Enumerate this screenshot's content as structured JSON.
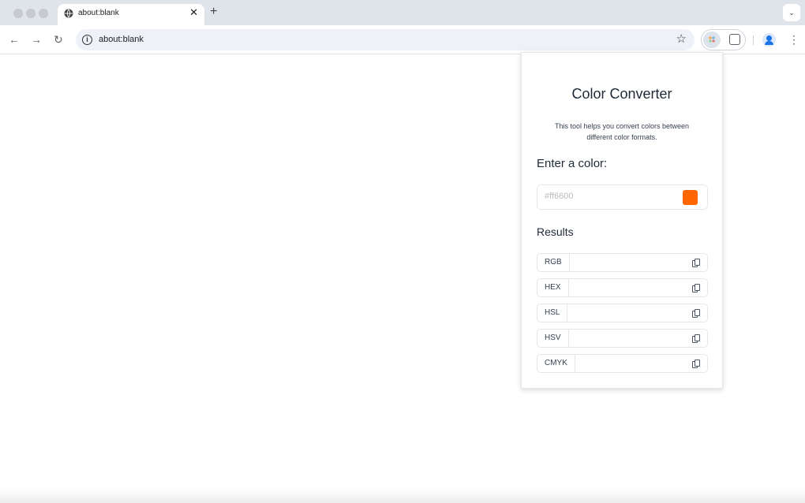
{
  "browser": {
    "tab_title": "about:blank",
    "tab_close": "✕",
    "new_tab": "+",
    "url": "about:blank",
    "star": "☆",
    "menu": "⋮",
    "back": "←",
    "forward": "→",
    "reload": "↻",
    "tab_search": "⌄",
    "info": "i"
  },
  "popup": {
    "title": "Color Converter",
    "description": "This tool helps you convert colors between different color formats.",
    "enter_label": "Enter a color:",
    "input_placeholder": "#ff6600",
    "input_value": "",
    "swatch_color": "#ff6600",
    "results_label": "Results",
    "results": [
      {
        "label": "RGB",
        "value": ""
      },
      {
        "label": "HEX",
        "value": ""
      },
      {
        "label": "HSL",
        "value": ""
      },
      {
        "label": "HSV",
        "value": ""
      },
      {
        "label": "CMYK",
        "value": ""
      }
    ]
  },
  "colors": {
    "accent": "#ff6600",
    "chrome_bg": "#dfe3ea",
    "omnibox_bg": "#eef1f8"
  },
  "icons": [
    "globe-icon",
    "close-icon",
    "plus-icon",
    "back-arrow-icon",
    "forward-arrow-icon",
    "reload-icon",
    "info-icon",
    "star-icon",
    "puzzle-icon",
    "profile-icon",
    "menu-icon",
    "copy-icon"
  ]
}
